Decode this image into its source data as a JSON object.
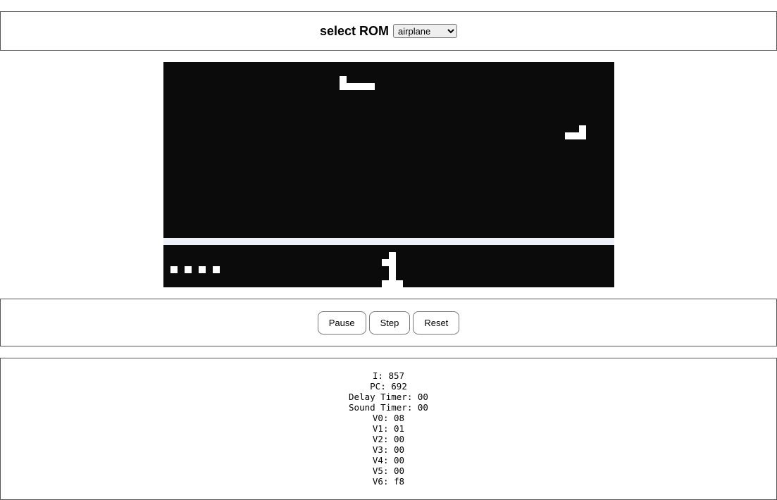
{
  "rom": {
    "label": "select ROM",
    "selected": "airplane"
  },
  "controls": {
    "pause_label": "Pause",
    "step_label": "Step",
    "reset_label": "Reset"
  },
  "registers": [
    {
      "name": "I",
      "value": "857"
    },
    {
      "name": "PC",
      "value": "692"
    },
    {
      "name": "Delay Timer",
      "value": "00"
    },
    {
      "name": "Sound Timer",
      "value": "00"
    },
    {
      "name": "V0",
      "value": "08"
    },
    {
      "name": "V1",
      "value": "01"
    },
    {
      "name": "V2",
      "value": "00"
    },
    {
      "name": "V3",
      "value": "00"
    },
    {
      "name": "V4",
      "value": "00"
    },
    {
      "name": "V5",
      "value": "00"
    },
    {
      "name": "V6",
      "value": "f8"
    }
  ],
  "colors": {
    "screen_bg": "#0b0b0c",
    "pixel_on": "#ffffff",
    "ground_band": "#eef1f7"
  }
}
